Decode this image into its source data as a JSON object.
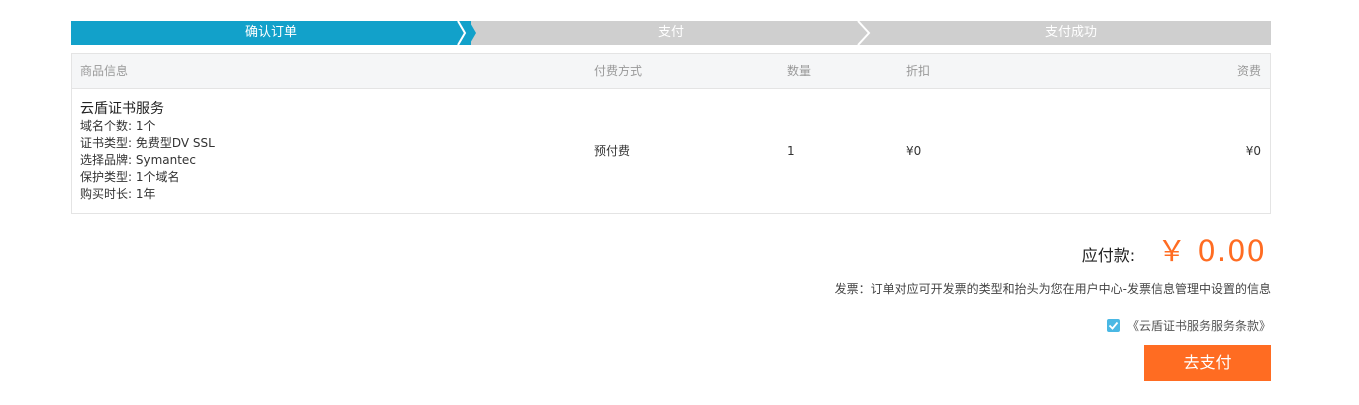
{
  "steps": [
    {
      "label": "确认订单",
      "active": true
    },
    {
      "label": "支付",
      "active": false
    },
    {
      "label": "支付成功",
      "active": false
    }
  ],
  "colors": {
    "active_step": "#12a1ca",
    "inactive_step": "#cfcfcf",
    "accent": "#ff6c22",
    "checkbox": "#4ab8e4"
  },
  "table": {
    "headers": {
      "product": "商品信息",
      "payment_method": "付费方式",
      "quantity": "数量",
      "discount": "折扣",
      "fee": "资费"
    },
    "rows": [
      {
        "product_name": "云盾证书服务",
        "specs": [
          "域名个数: 1个",
          "证书类型: 免费型DV SSL",
          "选择品牌: Symantec",
          "保护类型: 1个域名",
          "购买时长: 1年"
        ],
        "payment_method": "预付费",
        "quantity": "1",
        "discount": "¥0",
        "fee": "¥0"
      }
    ]
  },
  "summary": {
    "due_label": "应付款:",
    "due_amount": "￥ 0.00",
    "invoice_note": "发票：订单对应可开发票的类型和抬头为您在用户中心-发票信息管理中设置的信息",
    "agreement_text": "《云盾证书服务服务条款》",
    "agreement_checked": true,
    "pay_button": "去支付"
  }
}
